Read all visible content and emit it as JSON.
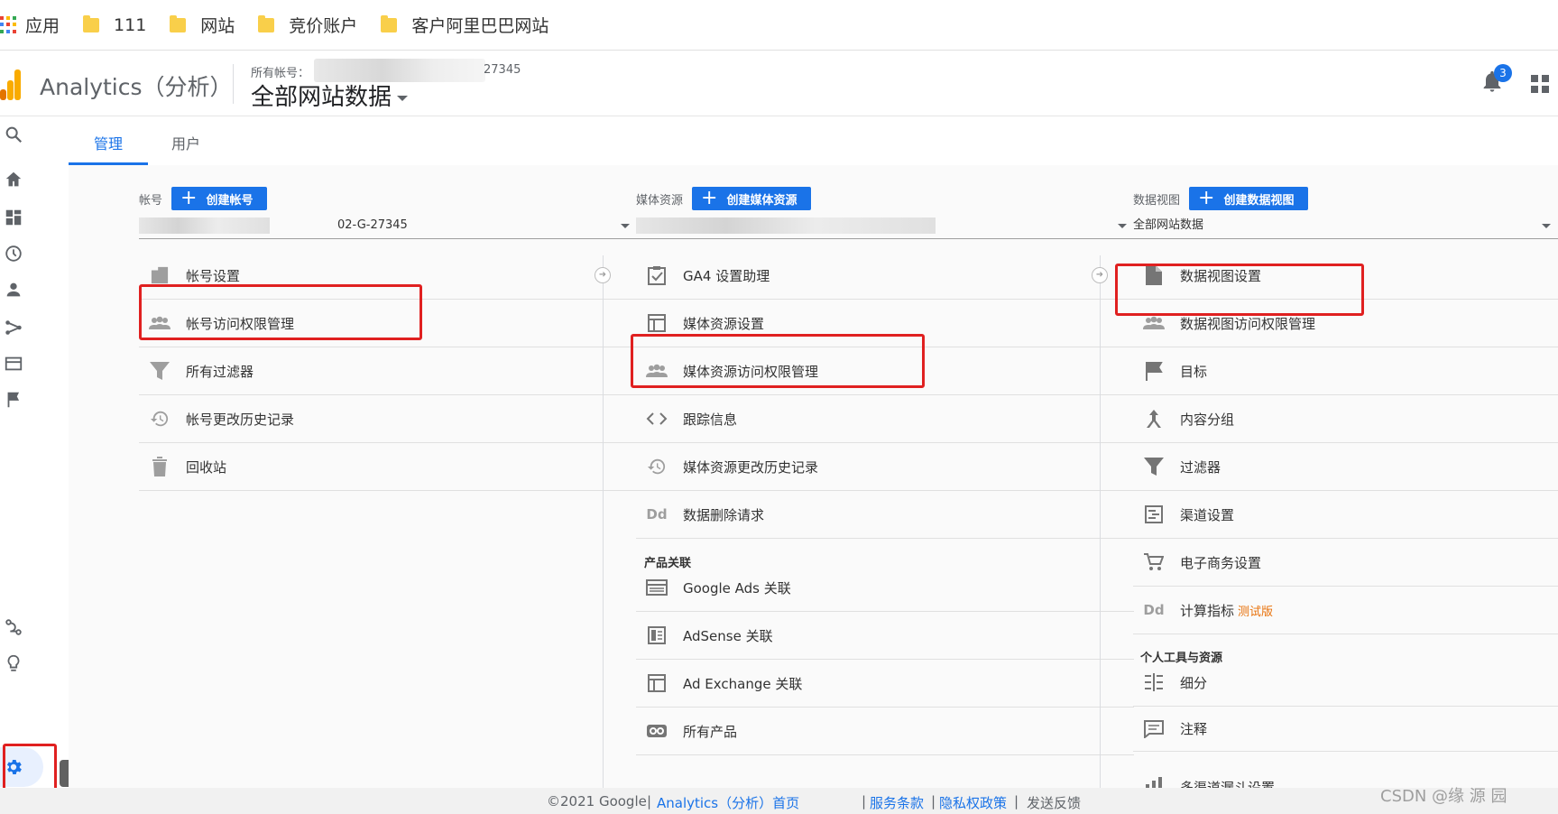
{
  "bookmarks": {
    "apps_label": "应用",
    "items": [
      "111",
      "网站",
      "竞价账户",
      "客户阿里巴巴网站"
    ]
  },
  "header": {
    "app_name": "Analytics（分析）",
    "account_path_label": "所有帐号：",
    "account_id_suffix": "27345",
    "view_title": "全部网站数据",
    "notification_count": "3"
  },
  "tabs": {
    "admin": "管理",
    "users": "用户"
  },
  "tooltip": "管理",
  "account_col": {
    "label": "帐号",
    "create_label": "创建帐号",
    "selector_value": "02-G-27345",
    "items": [
      {
        "icon": "building-icon",
        "label": "帐号设置"
      },
      {
        "icon": "people-icon",
        "label": "帐号访问权限管理"
      },
      {
        "icon": "filter-icon",
        "label": "所有过滤器"
      },
      {
        "icon": "history-icon",
        "label": "帐号更改历史记录"
      },
      {
        "icon": "trash-icon",
        "label": "回收站"
      }
    ]
  },
  "property_col": {
    "label": "媒体资源",
    "create_label": "创建媒体资源",
    "selector_value": "",
    "items": [
      {
        "icon": "checklist-icon",
        "label": "GA4 设置助理"
      },
      {
        "icon": "layout-icon",
        "label": "媒体资源设置"
      },
      {
        "icon": "people-icon",
        "label": "媒体资源访问权限管理"
      },
      {
        "icon": "code-icon",
        "label": "跟踪信息"
      },
      {
        "icon": "history-icon",
        "label": "媒体资源更改历史记录"
      },
      {
        "icon": "dd-icon",
        "label": "数据删除请求"
      }
    ],
    "section_label": "产品关联",
    "product_items": [
      {
        "icon": "ads-icon",
        "label": "Google Ads 关联"
      },
      {
        "icon": "adsense-icon",
        "label": "AdSense 关联"
      },
      {
        "icon": "adexchange-icon",
        "label": "Ad Exchange 关联"
      },
      {
        "icon": "link-icon",
        "label": "所有产品"
      }
    ]
  },
  "view_col": {
    "label": "数据视图",
    "create_label": "创建数据视图",
    "selector_value": "全部网站数据",
    "items": [
      {
        "icon": "document-icon",
        "label": "数据视图设置"
      },
      {
        "icon": "people-icon",
        "label": "数据视图访问权限管理"
      },
      {
        "icon": "flag-icon",
        "label": "目标"
      },
      {
        "icon": "content-group-icon",
        "label": "内容分组"
      },
      {
        "icon": "filter-icon",
        "label": "过滤器"
      },
      {
        "icon": "channel-icon",
        "label": "渠道设置"
      },
      {
        "icon": "cart-icon",
        "label": "电子商务设置"
      },
      {
        "icon": "dd-icon",
        "label": "计算指标",
        "badge": "测试版"
      }
    ],
    "section_label": "个人工具与资源",
    "tool_items": [
      {
        "icon": "segment-icon",
        "label": "细分"
      },
      {
        "icon": "annotation-icon",
        "label": "注释"
      },
      {
        "icon": "funnel-icon",
        "label": "多渠道漏斗设置"
      }
    ]
  },
  "footer": {
    "copyright": "©2021 Google",
    "analytics_home": "Analytics（分析）首页",
    "terms": "服务条款",
    "privacy": "隐私权政策",
    "feedback": "发送反馈"
  },
  "watermark": "CSDN @缘 源 园"
}
